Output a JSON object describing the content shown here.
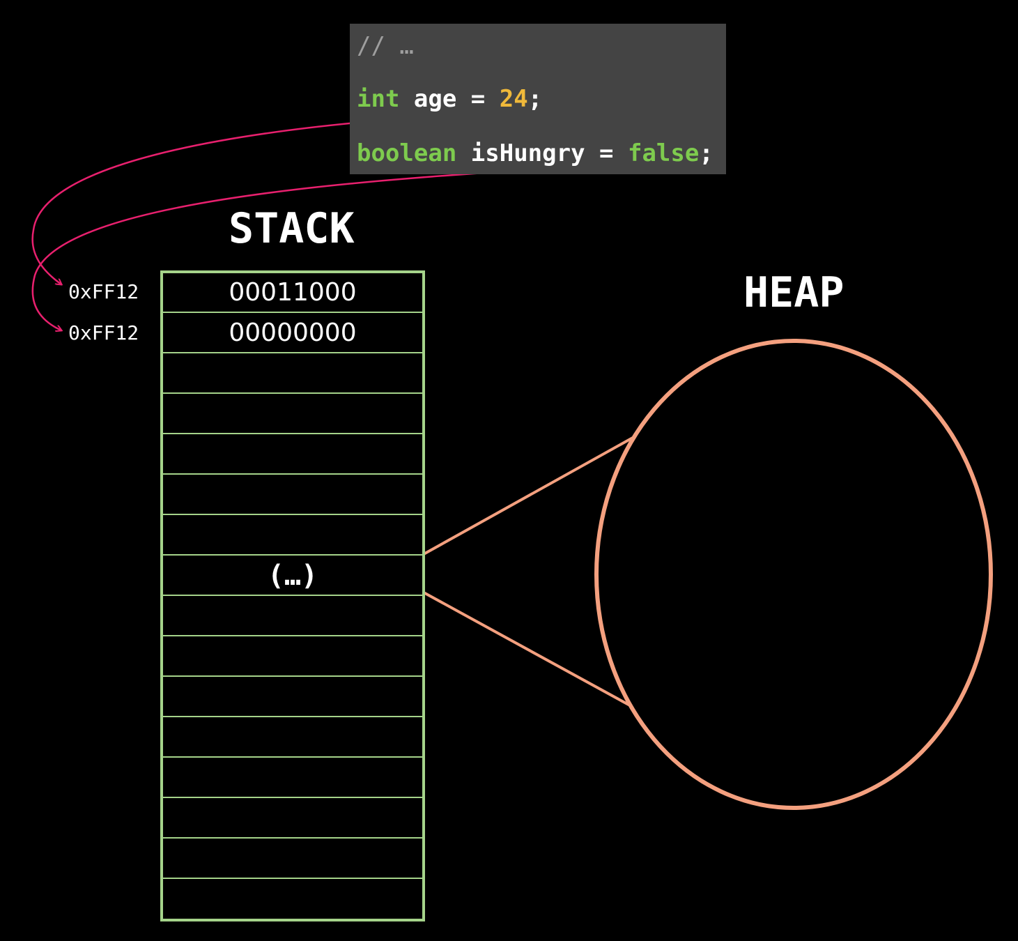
{
  "code": {
    "comment": "// …",
    "line2": {
      "type": "int",
      "name": "age",
      "eq": " = ",
      "value": "24",
      "semi": ";"
    },
    "line3": {
      "type": "boolean",
      "name": "isHungry",
      "eq": " = ",
      "value": "false",
      "semi": ";"
    }
  },
  "stack": {
    "title": "STACK",
    "cells": [
      "00011000",
      "00000000",
      "",
      "",
      "",
      "",
      "",
      "(…)",
      "",
      "",
      "",
      "",
      "",
      "",
      "",
      ""
    ],
    "addresses": [
      "0xFF12",
      "0xFF12"
    ]
  },
  "heap": {
    "title": "HEAP"
  },
  "colors": {
    "background": "#000000",
    "code_bg": "#444444",
    "keyword": "#7ecb4e",
    "number": "#f0b93a",
    "comment": "#9e9e9e",
    "stack_border": "#a5d38a",
    "heap_border": "#f4a07f",
    "arrow": "#e8206e"
  }
}
